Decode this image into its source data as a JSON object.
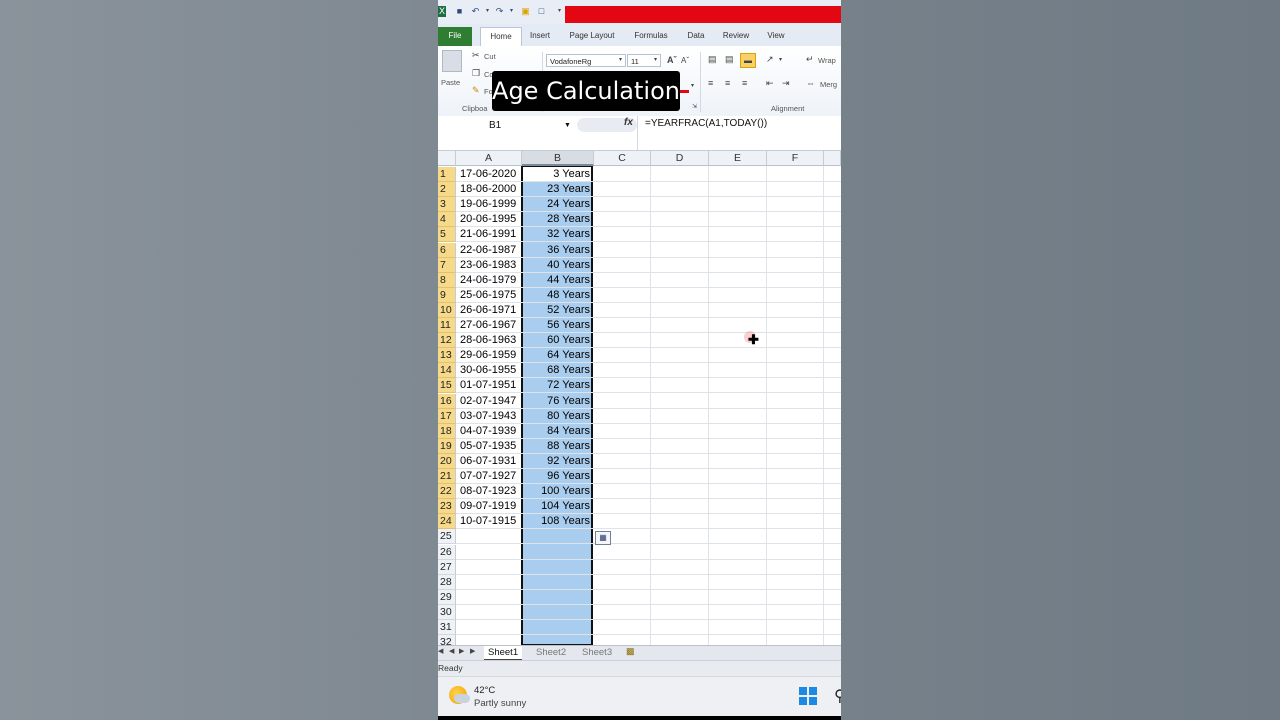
{
  "caption": "Age Calculation",
  "ribbon": {
    "tabs": [
      {
        "label": "File"
      },
      {
        "label": "Home"
      },
      {
        "label": "Insert"
      },
      {
        "label": "Page Layout"
      },
      {
        "label": "Formulas"
      },
      {
        "label": "Data"
      },
      {
        "label": "Review"
      },
      {
        "label": "View"
      }
    ],
    "clipboard": {
      "paste_label": "Paste",
      "cut_label": "Cut",
      "copy_label": "Co",
      "format_label": "Fo",
      "group_label": "Clipboa"
    },
    "font": {
      "name": "VodafoneRg",
      "size": "11"
    },
    "alignment": {
      "wrap_label": "Wrap",
      "merge_label": "Merg",
      "group_label": "Alignment"
    }
  },
  "formula_bar": {
    "name_box": "B1",
    "fx": "fx",
    "formula": "=YEARFRAC(A1,TODAY())"
  },
  "grid": {
    "columns": [
      "A",
      "B",
      "C",
      "D",
      "E",
      "F"
    ],
    "rows": [
      {
        "n": "1",
        "a": "17-06-2020",
        "b": "3 Years"
      },
      {
        "n": "2",
        "a": "18-06-2000",
        "b": "23 Years"
      },
      {
        "n": "3",
        "a": "19-06-1999",
        "b": "24 Years"
      },
      {
        "n": "4",
        "a": "20-06-1995",
        "b": "28 Years"
      },
      {
        "n": "5",
        "a": "21-06-1991",
        "b": "32 Years"
      },
      {
        "n": "6",
        "a": "22-06-1987",
        "b": "36 Years"
      },
      {
        "n": "7",
        "a": "23-06-1983",
        "b": "40 Years"
      },
      {
        "n": "8",
        "a": "24-06-1979",
        "b": "44 Years"
      },
      {
        "n": "9",
        "a": "25-06-1975",
        "b": "48 Years"
      },
      {
        "n": "10",
        "a": "26-06-1971",
        "b": "52 Years"
      },
      {
        "n": "11",
        "a": "27-06-1967",
        "b": "56 Years"
      },
      {
        "n": "12",
        "a": "28-06-1963",
        "b": "60 Years"
      },
      {
        "n": "13",
        "a": "29-06-1959",
        "b": "64 Years"
      },
      {
        "n": "14",
        "a": "30-06-1955",
        "b": "68 Years"
      },
      {
        "n": "15",
        "a": "01-07-1951",
        "b": "72 Years"
      },
      {
        "n": "16",
        "a": "02-07-1947",
        "b": "76 Years"
      },
      {
        "n": "17",
        "a": "03-07-1943",
        "b": "80 Years"
      },
      {
        "n": "18",
        "a": "04-07-1939",
        "b": "84 Years"
      },
      {
        "n": "19",
        "a": "05-07-1935",
        "b": "88 Years"
      },
      {
        "n": "20",
        "a": "06-07-1931",
        "b": "92 Years"
      },
      {
        "n": "21",
        "a": "07-07-1927",
        "b": "96 Years"
      },
      {
        "n": "22",
        "a": "08-07-1923",
        "b": "100 Years"
      },
      {
        "n": "23",
        "a": "09-07-1919",
        "b": "104 Years"
      },
      {
        "n": "24",
        "a": "10-07-1915",
        "b": "108 Years"
      },
      {
        "n": "25",
        "a": "",
        "b": ""
      },
      {
        "n": "26",
        "a": "",
        "b": ""
      },
      {
        "n": "27",
        "a": "",
        "b": ""
      },
      {
        "n": "28",
        "a": "",
        "b": ""
      },
      {
        "n": "29",
        "a": "",
        "b": ""
      },
      {
        "n": "30",
        "a": "",
        "b": ""
      },
      {
        "n": "31",
        "a": "",
        "b": ""
      },
      {
        "n": "32",
        "a": "",
        "b": ""
      }
    ]
  },
  "sheet_tabs": [
    "Sheet1",
    "Sheet2",
    "Sheet3"
  ],
  "status": "Ready",
  "taskbar": {
    "temperature": "42°C",
    "condition": "Partly sunny"
  },
  "colors": {
    "selection_fill": "#a9cdee",
    "row_header_highlight": "#f7d98a",
    "file_tab": "#2e7d32",
    "title_bar_red": "#e30613"
  }
}
